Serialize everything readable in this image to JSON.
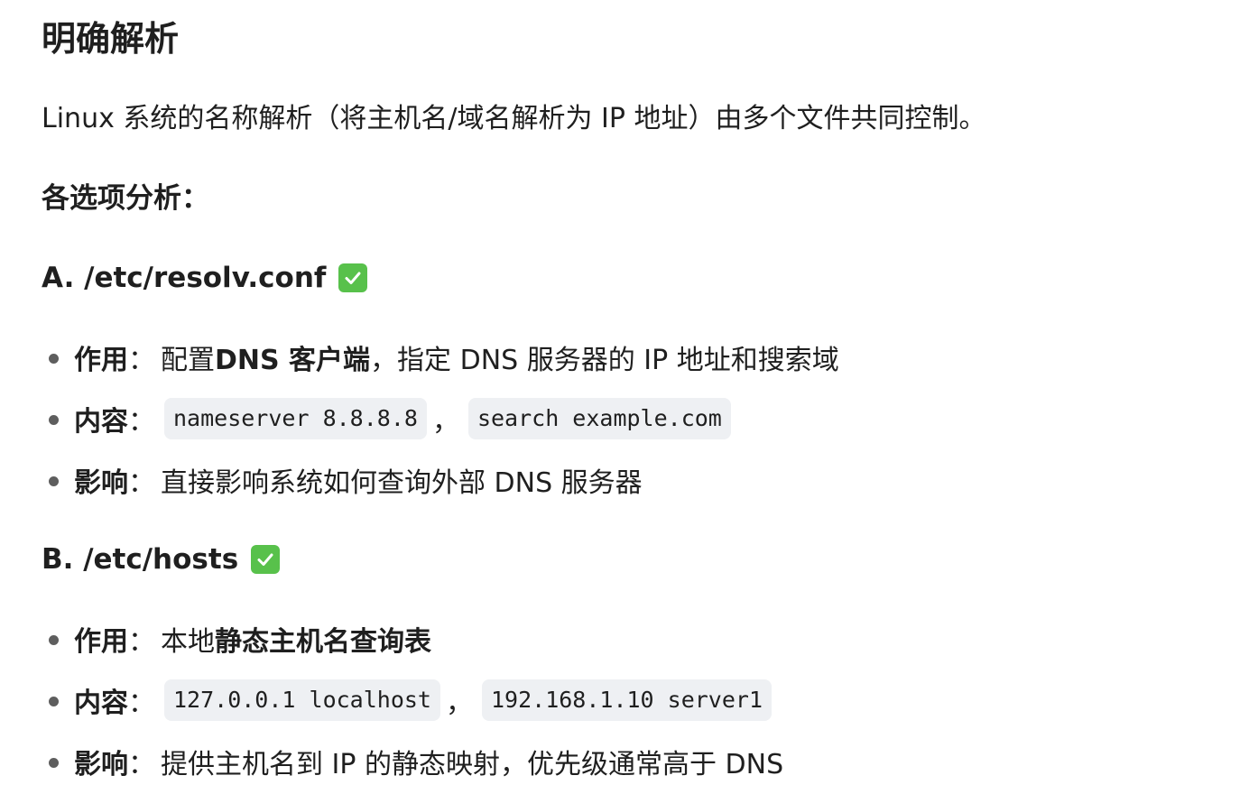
{
  "title": "明确解析",
  "intro": "Linux 系统的名称解析（将主机名/域名解析为 IP 地址）由多个文件共同控制。",
  "subheading": "各选项分析：",
  "options": [
    {
      "heading": "A. /etc/resolv.conf",
      "icon": "check-mark-icon",
      "bullets": {
        "purpose": {
          "label": "作用",
          "sep": "：",
          "text1": "配置 ",
          "bold": "DNS 客户端",
          "text2": "，指定 DNS 服务器的 IP 地址和搜索域"
        },
        "content": {
          "label": "内容",
          "sep": "：",
          "code1": "nameserver 8.8.8.8",
          "comma": "，",
          "code2": "search example.com"
        },
        "impact": {
          "label": "影响",
          "sep": "：",
          "text": "直接影响系统如何查询外部 DNS 服务器"
        }
      }
    },
    {
      "heading": "B. /etc/hosts",
      "icon": "check-mark-icon",
      "bullets": {
        "purpose": {
          "label": "作用",
          "sep": "：",
          "text1": "本地",
          "bold": "静态主机名查询表"
        },
        "content": {
          "label": "内容",
          "sep": "：",
          "code1": "127.0.0.1 localhost",
          "comma": "，",
          "code2": "192.168.1.10 server1"
        },
        "impact": {
          "label": "影响",
          "sep": "：",
          "text": "提供主机名到 IP 的静态映射，优先级通常高于 DNS"
        }
      }
    }
  ],
  "colors": {
    "check_badge": "#58c14b",
    "code_background": "#eef0f3",
    "text": "#1f1f1f"
  }
}
